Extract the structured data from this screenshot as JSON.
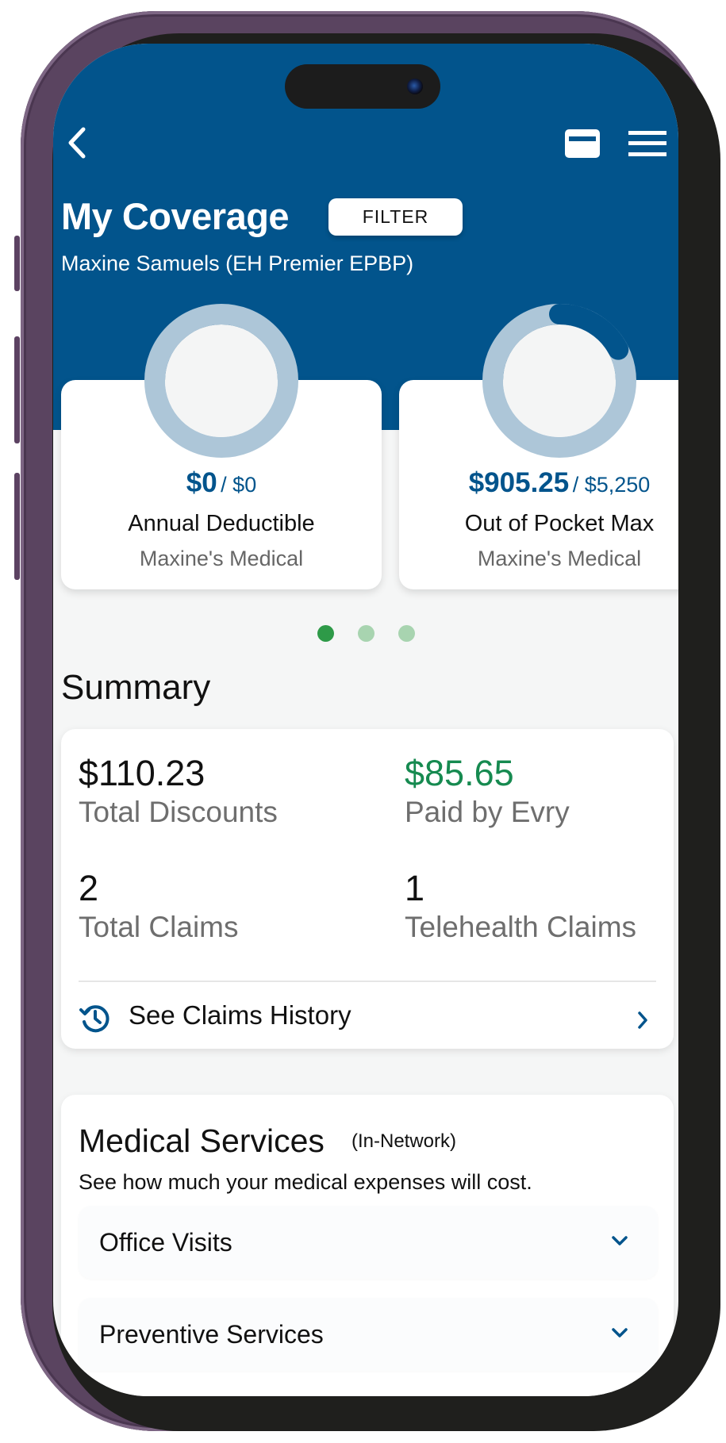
{
  "header": {
    "title": "My Coverage",
    "filter_label": "FILTER",
    "subtitle": "Maxine Samuels (EH Premier EPBP)"
  },
  "gauges": [
    {
      "amount": "$0",
      "limit": "/ $0",
      "label": "Annual Deductible",
      "sub": "Maxine's Medical",
      "progress": 0
    },
    {
      "amount": "$905.25",
      "limit": "/ $5,250",
      "label": "Out of Pocket Max",
      "sub": "Maxine's Medical",
      "progress": 0.1724
    }
  ],
  "carousel": {
    "pages": 3,
    "active": 0
  },
  "summary": {
    "heading": "Summary",
    "stats": [
      {
        "value": "$110.23",
        "label": "Total Discounts",
        "highlight": false
      },
      {
        "value": "$85.65",
        "label": "Paid by Evry",
        "highlight": true
      },
      {
        "value": "2",
        "label": "Total Claims",
        "highlight": false
      },
      {
        "value": "1",
        "label": "Telehealth Claims",
        "highlight": false
      }
    ],
    "history_link": "See Claims History"
  },
  "medical": {
    "title": "Medical Services",
    "tag": "(In-Network)",
    "description": "See how much your medical expenses will cost.",
    "items": [
      {
        "label": "Office Visits"
      },
      {
        "label": "Preventive Services"
      }
    ]
  },
  "colors": {
    "brand_blue": "#02548c",
    "gauge_track": "#adc6d8",
    "green": "#168a50",
    "dot_active": "#2e9a48",
    "dot_inactive": "#a8d4b0"
  }
}
